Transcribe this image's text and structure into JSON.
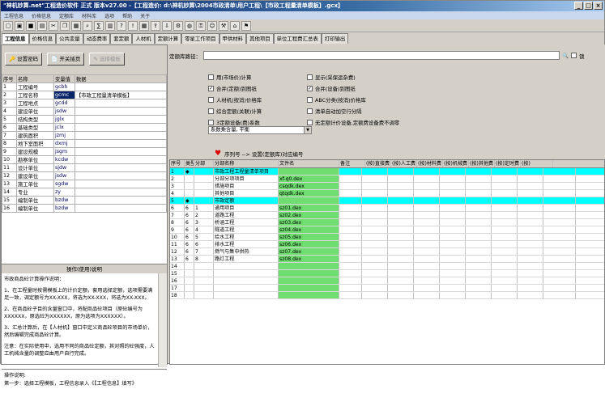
{
  "window": {
    "title": "\"神机妙算.net\"工程造价软件 正式 版本v27.00 -【工程造价: d:\\神机妙算\\2004市政清单\\用户工程\\【市政工程量清单模板】.gcx】",
    "buttons": [
      "_",
      "□",
      "×"
    ]
  },
  "taskbar": [
    "工程信息",
    "价格信息",
    "定额库",
    "材料库",
    "选项",
    "帮助",
    "关于"
  ],
  "toolbar_icons": [
    "new-icon",
    "open-icon",
    "save-icon",
    "print-icon",
    "cut-icon",
    "copy-icon",
    "paste-icon",
    "find-icon",
    "calc-icon",
    "chart-icon",
    "help-icon",
    "info-icon",
    "table-icon",
    "export-icon",
    "import-icon",
    "settings-icon",
    "globe-icon",
    "lock-icon",
    "user-icon",
    "tool-icon",
    "home-icon",
    "flag-icon"
  ],
  "tabs": [
    "工程信息",
    "价格信息",
    "公共变量",
    "动态费率",
    "套定额",
    "人材机",
    "定额计算",
    "零星工作项目",
    "甲供材料",
    "其他项目",
    "单位工程费汇总表",
    "打印输出"
  ],
  "left": {
    "buttons": {
      "set_password": "设置密码",
      "related_attach": "开关插页",
      "select_template": "选择模板"
    },
    "table_headers": [
      "序号",
      "名称",
      "变量值",
      "数据"
    ],
    "rows": [
      {
        "no": "1",
        "name": "工程编号",
        "code": "gcbh",
        "data": ""
      },
      {
        "no": "2",
        "name": "工程名称",
        "code": "gcmc",
        "data": "【市政工程量清单模板】"
      },
      {
        "no": "3",
        "name": "工程地点",
        "code": "gcdd",
        "data": ""
      },
      {
        "no": "4",
        "name": "建设单位",
        "code": "jsdw",
        "data": ""
      },
      {
        "no": "5",
        "name": "结构类型",
        "code": "jglx",
        "data": ""
      },
      {
        "no": "6",
        "name": "基础类型",
        "code": "jclx",
        "data": ""
      },
      {
        "no": "7",
        "name": "建筑面积",
        "code": "jzmj",
        "data": ""
      },
      {
        "no": "8",
        "name": "地下室面积",
        "code": "dxmj",
        "data": ""
      },
      {
        "no": "9",
        "name": "建设规模",
        "code": "jsgm",
        "data": ""
      },
      {
        "no": "10",
        "name": "勘察单位",
        "code": "kcdw",
        "data": ""
      },
      {
        "no": "11",
        "name": "设计单位",
        "code": "sjdw",
        "data": ""
      },
      {
        "no": "12",
        "name": "建设单位",
        "code": "jsdw",
        "data": ""
      },
      {
        "no": "13",
        "name": "施工单位",
        "code": "sgdw",
        "data": ""
      },
      {
        "no": "14",
        "name": "专业",
        "code": "zy",
        "data": ""
      },
      {
        "no": "15",
        "name": "编制单位",
        "code": "bzdw",
        "data": ""
      },
      {
        "no": "16",
        "name": "编制单位",
        "code": "bzdw",
        "data": ""
      }
    ],
    "info_title": "操作(使用)说明",
    "info_paragraphs": [
      "市政商品砼计算操作说明：",
      "1、在工程量时按需模板上的计价定额，套用选择定额，选项需要满足一致，调定额号为XX-XXX，将选为XX-XXX，将选为XX-XXX。",
      "2、在商品砼子目的含量窗口中，将配商品砼项目（原砼编号为XXXXXX，原选砼为XXXXXX，原为选项为XXXXXX）。",
      "3、汇总计算后，在【人材机】窗口中定义商品砼项目的市场单价，然后编辑完成商品砼计算。",
      "注意：在实际使用中，选用不同的商品砼定额，其对照的砼强度，人工机械含量的调整应由用户自行完成。"
    ],
    "op_title": "操作说明:",
    "op_text": "第一步：选择工程模板，工程信息录入《【工程信息】填写》"
  },
  "right": {
    "path_label": "定额库路径：",
    "lock_label": "锁",
    "checkboxes": [
      {
        "label": "用(市场价)计算",
        "checked": false
      },
      {
        "label": "显示(采保运杂费)",
        "checked": false
      },
      {
        "label": "合并(定额)到图纸",
        "checked": true
      },
      {
        "label": "合并(设备)到图纸",
        "checked": true
      },
      {
        "label": "人材机(按消)价格库",
        "checked": false
      },
      {
        "label": "ABC分类(按消)价格库",
        "checked": false
      },
      {
        "label": "综合定额(关联)计算",
        "checked": false
      },
      {
        "label": "清单自动加空行分隔",
        "checked": false
      },
      {
        "label": "3定额设备(费)系数",
        "checked": false
      },
      {
        "label": "无定额计价设备,定额费设备费不调零",
        "checked": false
      }
    ],
    "select_value": "系数乘含量, 平衡",
    "hint": "序列号 --> 设置(定额库)对应编号",
    "grid_headers": [
      "序号",
      "类型",
      "分部",
      "分部名称",
      "文件名",
      "备注",
      "(按)直接费",
      "(按)人工费",
      "(按)材料费",
      "(按)机械费",
      "(按)其他费",
      "(按)定时费",
      "(按)"
    ],
    "grid_rows": [
      {
        "no": "1",
        "type": "◆",
        "part": "",
        "name": "市政工程工程量清单项目",
        "file": "",
        "cyan": true
      },
      {
        "no": "2",
        "type": "",
        "part": "",
        "name": "分部分项项目",
        "file": "xf-q0.dex",
        "cyan": false
      },
      {
        "no": "3",
        "type": "",
        "part": "",
        "name": "措施项目",
        "file": "csqdk.dex",
        "cyan": false
      },
      {
        "no": "4",
        "type": "",
        "part": "",
        "name": "其他项目",
        "file": "qtqdk.dex",
        "cyan": false
      },
      {
        "no": "5",
        "type": "◆",
        "part": "",
        "name": "市政定额",
        "file": "",
        "cyan": true
      },
      {
        "no": "6",
        "type": "6",
        "part": "1",
        "name": "通用项目",
        "file": "sz01.dex",
        "cyan": false
      },
      {
        "no": "7",
        "type": "6",
        "part": "2",
        "name": "道路工程",
        "file": "sz02.dex",
        "cyan": false
      },
      {
        "no": "8",
        "type": "6",
        "part": "3",
        "name": "桥涵工程",
        "file": "sz03.dex",
        "cyan": false
      },
      {
        "no": "9",
        "type": "6",
        "part": "4",
        "name": "隧道工程",
        "file": "sz04.dex",
        "cyan": false
      },
      {
        "no": "10",
        "type": "6",
        "part": "5",
        "name": "给水工程",
        "file": "sz05.dex",
        "cyan": false
      },
      {
        "no": "11",
        "type": "6",
        "part": "6",
        "name": "排水工程",
        "file": "sz06.dex",
        "cyan": false
      },
      {
        "no": "12",
        "type": "6",
        "part": "7",
        "name": "燃气与集中供热",
        "file": "sz07.dex",
        "cyan": false
      },
      {
        "no": "13",
        "type": "6",
        "part": "8",
        "name": "路灯工程",
        "file": "sz08.dex",
        "cyan": false
      },
      {
        "no": "14",
        "type": "",
        "part": "",
        "name": "",
        "file": "",
        "cyan": false
      },
      {
        "no": "15",
        "type": "",
        "part": "",
        "name": "",
        "file": "",
        "cyan": false
      },
      {
        "no": "16",
        "type": "",
        "part": "",
        "name": "",
        "file": "",
        "cyan": false
      },
      {
        "no": "17",
        "type": "",
        "part": "",
        "name": "",
        "file": "",
        "cyan": false
      },
      {
        "no": "18",
        "type": "",
        "part": "",
        "name": "",
        "file": "",
        "cyan": false
      }
    ]
  }
}
